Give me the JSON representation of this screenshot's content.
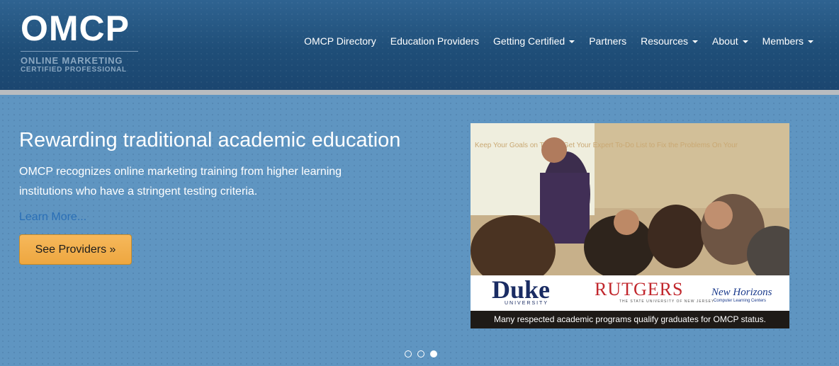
{
  "logo": {
    "main": "OMCP",
    "line1": "ONLINE MARKETING",
    "line2": "CERTIFIED PROFESSIONAL"
  },
  "nav": {
    "items": [
      {
        "label": "OMCP Directory",
        "dropdown": false
      },
      {
        "label": "Education Providers",
        "dropdown": false
      },
      {
        "label": "Getting Certified",
        "dropdown": true
      },
      {
        "label": "Partners",
        "dropdown": false
      },
      {
        "label": "Resources",
        "dropdown": true
      },
      {
        "label": "About",
        "dropdown": true
      },
      {
        "label": "Members",
        "dropdown": true
      }
    ]
  },
  "hero": {
    "title": "Rewarding traditional academic education",
    "text": "OMCP recognizes online marketing training from higher learning institutions who have a stringent testing criteria.",
    "learn_more": "Learn More...",
    "button": "See Providers »"
  },
  "slide": {
    "photo_text": "Keep Your Goals on Target! Get Your Expert To-Do List to Fix the Problems On Your",
    "logos": {
      "duke": "Duke",
      "duke_sub": "UNIVERSITY",
      "rutgers": "RUTGERS",
      "rutgers_sub": "THE STATE UNIVERSITY OF NEW JERSEY",
      "new_horizons": "New Horizons",
      "new_horizons_sub": "Computer Learning Centers"
    },
    "caption": "Many respected academic programs qualify graduates for OMCP status."
  },
  "carousel": {
    "slide_count": 3,
    "active_index": 2
  },
  "colors": {
    "header_bg": "#1f4e78",
    "hero_bg": "#5f95c1",
    "button_bg": "#f0a944",
    "link": "#2a6fb6"
  }
}
